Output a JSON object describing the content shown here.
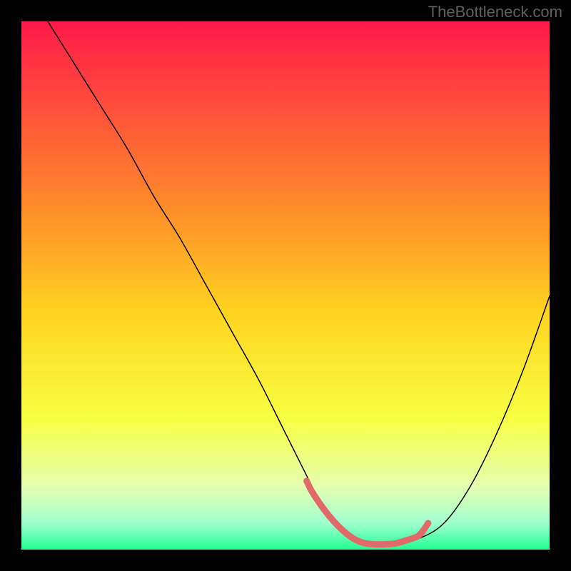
{
  "watermark": "TheBottleneck.com",
  "chart_data": {
    "type": "line",
    "title": "",
    "xlabel": "",
    "ylabel": "",
    "xlim": [
      0,
      100
    ],
    "ylim": [
      0,
      100
    ],
    "background_gradient": {
      "stops": [
        {
          "offset": 0,
          "color": "#ff1a49"
        },
        {
          "offset": 35,
          "color": "#ff8b2a"
        },
        {
          "offset": 55,
          "color": "#ffd320"
        },
        {
          "offset": 75,
          "color": "#f8ff42"
        },
        {
          "offset": 88,
          "color": "#e5ffb0"
        },
        {
          "offset": 95,
          "color": "#a0ffcf"
        },
        {
          "offset": 100,
          "color": "#22ff91"
        }
      ]
    },
    "series": [
      {
        "name": "bottleneck-curve",
        "type": "line",
        "color": "#000000",
        "width": 1.5,
        "x": [
          5,
          10,
          15,
          20,
          25,
          30,
          35,
          40,
          45,
          50,
          55,
          57,
          60,
          63,
          66,
          70,
          75,
          80,
          85,
          90,
          95,
          100
        ],
        "y": [
          100,
          92,
          84,
          76,
          67,
          59,
          50,
          41,
          32,
          22,
          12,
          8,
          4,
          2,
          1,
          1,
          2,
          5,
          12,
          22,
          34,
          48
        ]
      },
      {
        "name": "highlight-segment",
        "type": "line",
        "color": "#e06a6a",
        "width": 9,
        "x": [
          54,
          55,
          57,
          59,
          61,
          63,
          65,
          67,
          69,
          71,
          73,
          75,
          76,
          77
        ],
        "y": [
          13,
          11,
          8,
          5.5,
          3.5,
          2,
          1.2,
          1,
          1,
          1.2,
          1.8,
          2.5,
          3.5,
          5
        ]
      }
    ]
  }
}
